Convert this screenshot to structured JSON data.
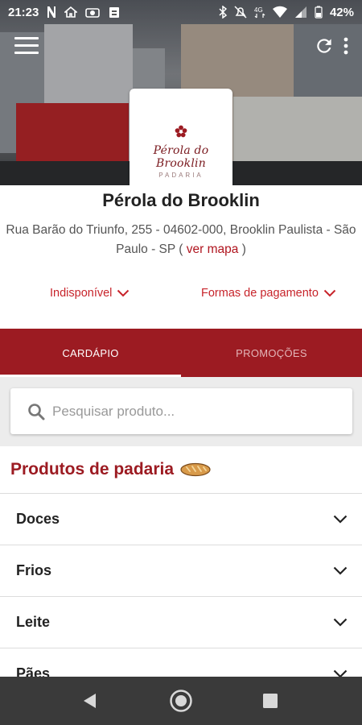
{
  "status_bar": {
    "time": "21:23",
    "notification_icons": [
      "n-icon",
      "home-icon",
      "camera-icon",
      "clipboard-icon"
    ],
    "system_icons": [
      "bluetooth-icon",
      "mute-icon",
      "data-4g-icon",
      "wifi-icon",
      "signal-icon",
      "battery-icon"
    ],
    "battery_percent": "42%"
  },
  "header": {
    "logo_text": "Pérola do Brooklin",
    "logo_subtext": "PADARIA",
    "menu_icon": "hamburger-menu-icon",
    "refresh_icon": "refresh-icon",
    "more_icon": "more-vertical-icon"
  },
  "store": {
    "name": "Pérola do Brooklin",
    "address": "Rua Barão do Triunfo, 255 - 04602-000, Brooklin Paulista - São Paulo - SP (",
    "map_link": "ver mapa",
    "address_close": ")",
    "availability": "Indisponível",
    "payment": "Formas de pagamento"
  },
  "tabs": [
    {
      "label": "CARDÁPIO",
      "active": true
    },
    {
      "label": "PROMOÇÕES",
      "active": false
    }
  ],
  "search": {
    "placeholder": "Pesquisar produto..."
  },
  "section": {
    "title": "Produtos de padaria",
    "icon": "bread-icon"
  },
  "categories": [
    {
      "label": "Doces"
    },
    {
      "label": "Frios"
    },
    {
      "label": "Leite"
    },
    {
      "label": "Pães"
    }
  ],
  "colors": {
    "primary": "#9c1b22",
    "accent_text": "#c7232a",
    "nav_bar": "#3a3a3a"
  }
}
